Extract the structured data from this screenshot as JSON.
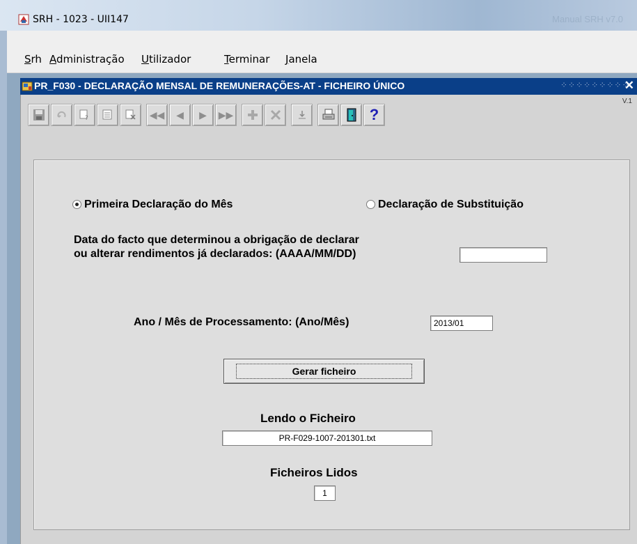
{
  "window": {
    "title": "SRH  - 1023 - UII147",
    "ghost_title": "Manual SRH v7.0"
  },
  "menu": [
    {
      "key": "S",
      "rest": "rh"
    },
    {
      "key": "A",
      "rest": "dministração"
    },
    {
      "key": "U",
      "rest": "tilizador"
    },
    {
      "key": "T",
      "rest": "erminar"
    },
    {
      "key": "J",
      "rest": "anela"
    }
  ],
  "form": {
    "title": "PR_F030 - DECLARAÇÃO MENSAL DE REMUNERAÇÕES-AT - FICHEIRO ÚNICO",
    "close_glyph": "✕",
    "version": "V.1"
  },
  "toolbar": {
    "icons": [
      "save-icon",
      "undo-icon",
      "query-icon",
      "query-all-icon",
      "clear-icon",
      "first-record-icon",
      "previous-record-icon",
      "next-record-icon",
      "last-record-icon",
      "insert-record-icon",
      "delete-record-icon",
      "download-icon",
      "print-icon",
      "exit-icon",
      "help-icon"
    ],
    "help_glyph": "?"
  },
  "declaration": {
    "option_first": "Primeira Declaração do Mês",
    "option_substitution": "Declaração de Substituição",
    "selected": "first",
    "date_label_line1": "Data do facto que determinou a obrigação de declarar",
    "date_label_line2": "ou alterar rendimentos já declarados: (AAAA/MM/DD)",
    "date_value": ""
  },
  "processing": {
    "label": "Ano / Mês de Processamento: (Ano/Mês)",
    "value": "2013/01"
  },
  "generate_button": "Gerar ficheiro",
  "reading": {
    "label": "Lendo o Ficheiro",
    "value": "PR-F029-1007-201301.txt"
  },
  "files_read": {
    "label": "Ficheiros Lidos",
    "value": "1"
  }
}
